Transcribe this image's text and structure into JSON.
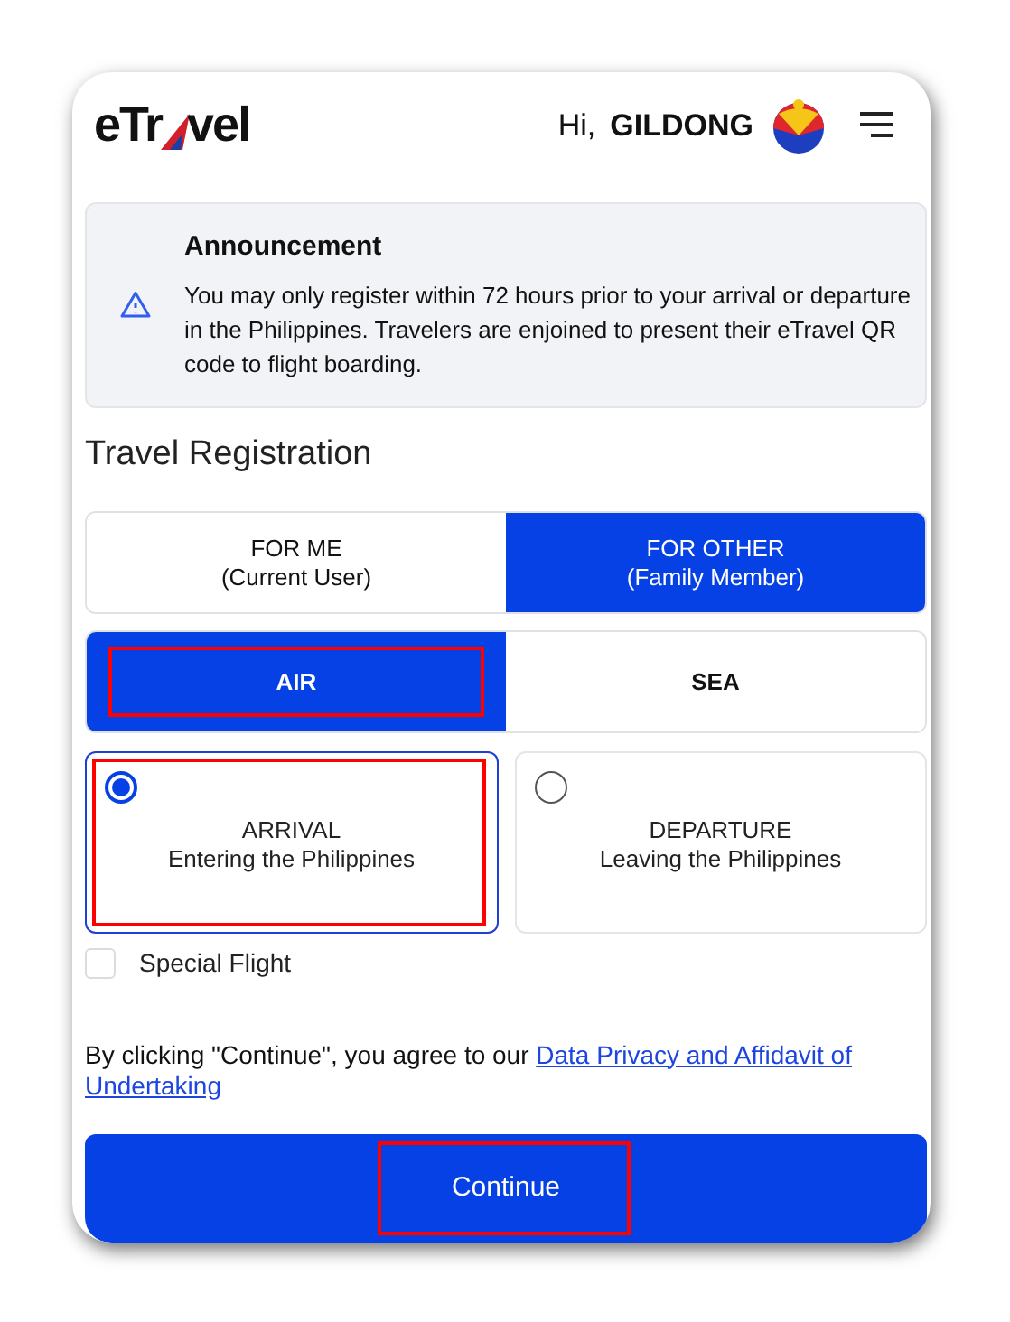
{
  "header": {
    "logo": [
      "eTr",
      "vel"
    ],
    "greeting": "Hi,",
    "user_name": "GILDONG"
  },
  "announcement": {
    "title": "Announcement",
    "body": "You may only register within 72 hours prior to your arrival or departure in the Philippines. Travelers are enjoined to present their eTravel QR code to flight boarding."
  },
  "section_title": "Travel Registration",
  "registrant_tabs": [
    {
      "label": "FOR ME",
      "sub": "(Current User)",
      "selected": false,
      "annotated": false
    },
    {
      "label": "FOR OTHER",
      "sub": "(Family Member)",
      "selected": true,
      "annotated": false
    }
  ],
  "mode_tabs": [
    {
      "label": "AIR",
      "selected": true,
      "annotated": true
    },
    {
      "label": "SEA",
      "selected": false,
      "annotated": false
    }
  ],
  "direction_options": [
    {
      "label": "ARRIVAL",
      "sub": "Entering the Philippines",
      "selected": true,
      "annotated": true
    },
    {
      "label": "DEPARTURE",
      "sub": "Leaving the Philippines",
      "selected": false,
      "annotated": false
    }
  ],
  "special_flight": {
    "label": "Special Flight",
    "checked": false
  },
  "consent": {
    "text": "By clicking \"Continue\", you agree to our",
    "link_lines": [
      "Data Privacy and Affidavit of",
      "Undertaking"
    ]
  },
  "continue_button": {
    "label": "Continue",
    "annotated": true
  }
}
